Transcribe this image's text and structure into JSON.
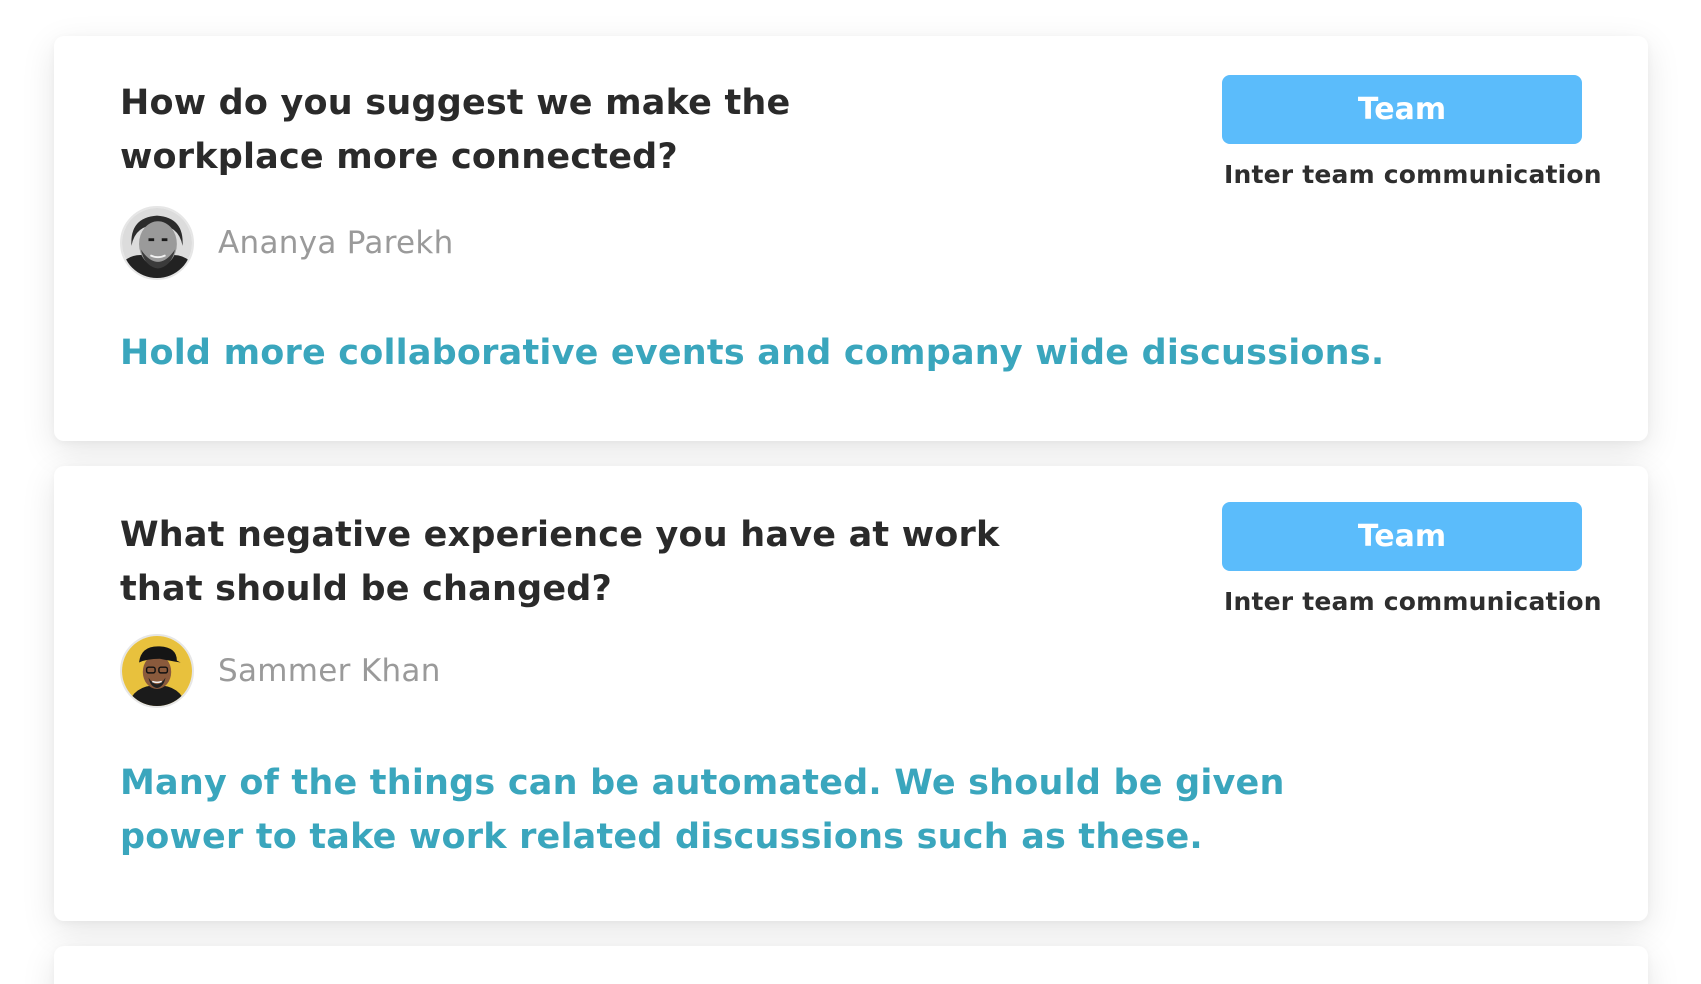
{
  "posts": [
    {
      "question": "How do you suggest we make the workplace more connected?",
      "author": {
        "name": "Ananya Parekh",
        "avatar": "person-avatar-grayscale"
      },
      "tag_label": "Team",
      "category": "Inter team communication",
      "answer": "Hold more collaborative events and company wide discussions."
    },
    {
      "question": "What negative experience you have at work that should be changed?",
      "author": {
        "name": "Sammer Khan",
        "avatar": "person-avatar-yellow-background"
      },
      "tag_label": "Team",
      "category": "Inter team communication",
      "answer": "Many of the things can be automated. We should be given power to take work related discussions such as these."
    }
  ],
  "colors": {
    "tag_button": "#5bbcfb",
    "answer_text": "#3aa6bd",
    "question_text": "#2a2a2a",
    "author_text": "#9a9a9a",
    "avatar_2_background": "#e8c13d"
  }
}
